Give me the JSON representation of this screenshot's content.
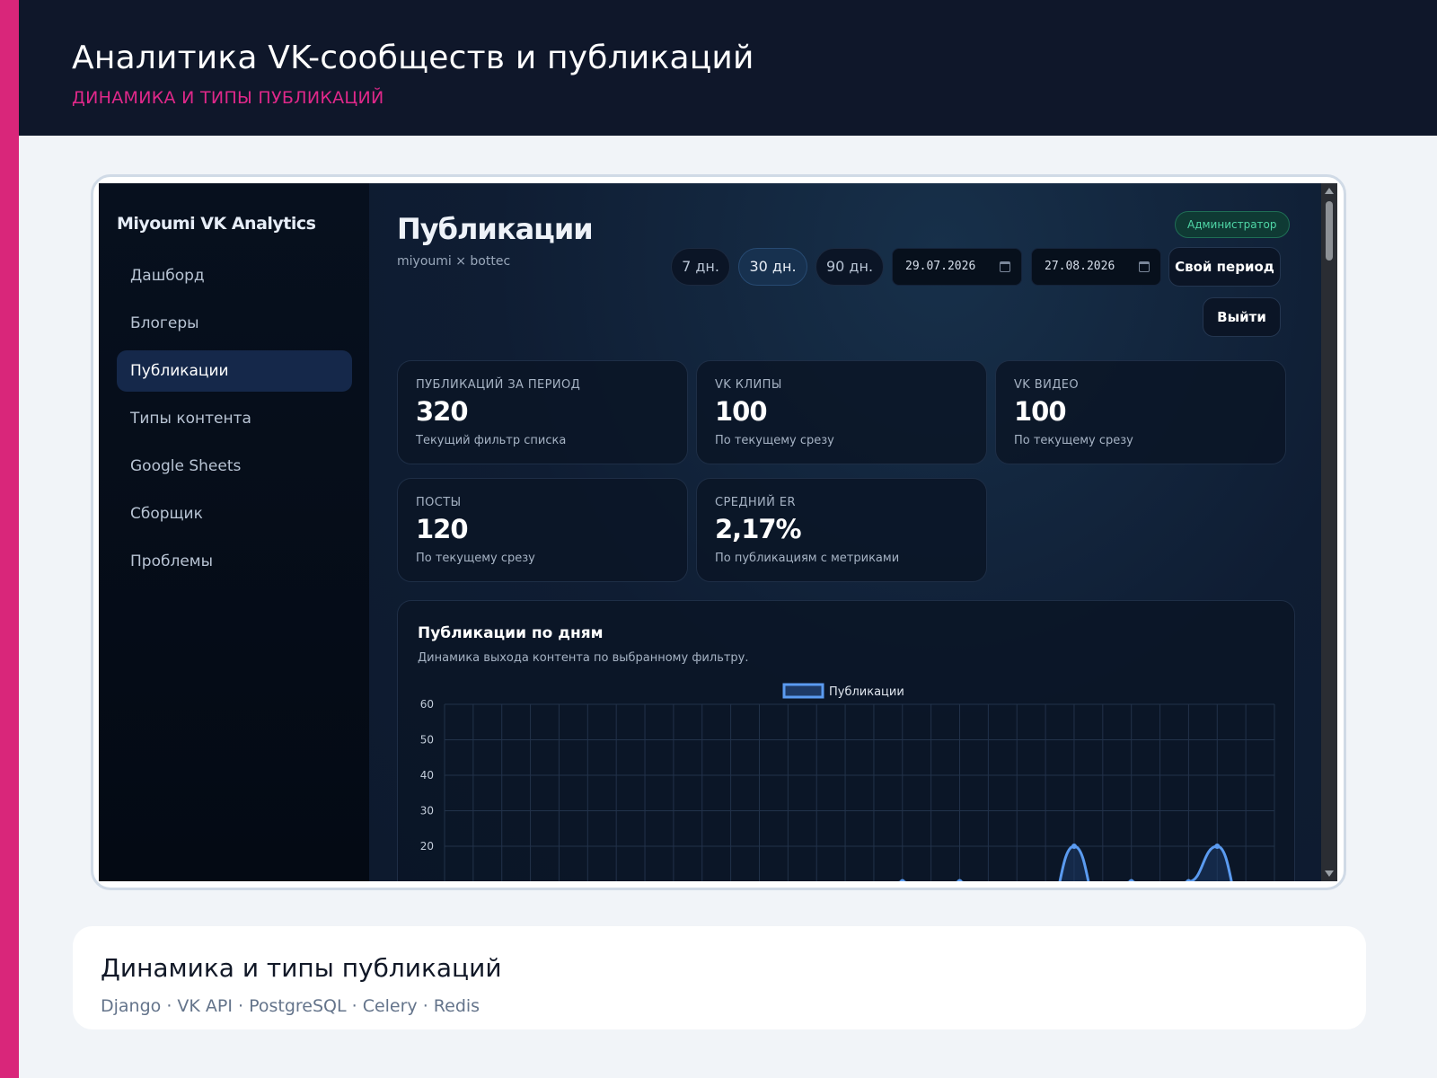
{
  "header": {
    "title": "Аналитика VK-сообществ и публикаций",
    "subtitle": "ДИНАМИКА И ТИПЫ ПУБЛИКАЦИЙ"
  },
  "app": {
    "brand": "Miyoumi VK Analytics",
    "sidebar": {
      "items": [
        {
          "label": "Дашборд",
          "active": false
        },
        {
          "label": "Блогеры",
          "active": false
        },
        {
          "label": "Публикации",
          "active": true
        },
        {
          "label": "Типы контента",
          "active": false
        },
        {
          "label": "Google Sheets",
          "active": false
        },
        {
          "label": "Сборщик",
          "active": false
        },
        {
          "label": "Проблемы",
          "active": false
        }
      ]
    },
    "page": {
      "title": "Публикации",
      "subtitle": "miyoumi × bottec",
      "role_badge": "Администратор"
    },
    "filters": {
      "periods": [
        {
          "label": "7 дн.",
          "active": false
        },
        {
          "label": "30 дн.",
          "active": true
        },
        {
          "label": "90 дн.",
          "active": false
        }
      ],
      "date_from": "29.07.2026",
      "date_to": "27.08.2026",
      "custom_period_label": "Свой период",
      "logout_label": "Выйти"
    },
    "stats": [
      {
        "label": "Публикаций за период",
        "value": "320",
        "note": "Текущий фильтр списка"
      },
      {
        "label": "VK клипы",
        "value": "100",
        "note": "По текущему срезу"
      },
      {
        "label": "VK видео",
        "value": "100",
        "note": "По текущему срезу"
      },
      {
        "label": "Посты",
        "value": "120",
        "note": "По текущему срезу"
      },
      {
        "label": "Средний ER",
        "value": "2,17%",
        "note": "По публикациям с метриками"
      }
    ],
    "chart_card": {
      "title": "Публикации по дням",
      "subtitle": "Динамика выхода контента по выбранному фильтру."
    }
  },
  "chart_data": {
    "type": "area",
    "legend": [
      "Публикации"
    ],
    "legend_placement": "top-center",
    "series": [
      {
        "name": "Публикации",
        "x_index": [
          0,
          1,
          2,
          3,
          4,
          5,
          6,
          7,
          8,
          9,
          10,
          11,
          12,
          13,
          14,
          15,
          16,
          17,
          18,
          19,
          20,
          21,
          22,
          23,
          24,
          25,
          26,
          27,
          28,
          29
        ],
        "values": [
          0,
          0,
          0,
          0,
          0,
          0,
          0,
          0,
          0,
          0,
          0,
          0,
          0,
          0,
          0,
          0,
          10,
          0,
          10,
          0,
          0,
          0,
          20,
          0,
          10,
          0,
          10,
          20,
          0,
          0
        ]
      }
    ],
    "y_ticks": [
      60,
      50,
      40,
      30,
      20
    ],
    "ylim": [
      0,
      60
    ],
    "grid": true,
    "line_color": "#5b9bf0",
    "fill_color": "#1e3a66"
  },
  "caption": {
    "title": "Динамика и типы публикаций",
    "tags": "Django · VK API · PostgreSQL · Celery · Redis"
  },
  "colors": {
    "accent": "#d9267a",
    "header_bg": "#0f172a",
    "badge_green": "#4fd6a6"
  }
}
